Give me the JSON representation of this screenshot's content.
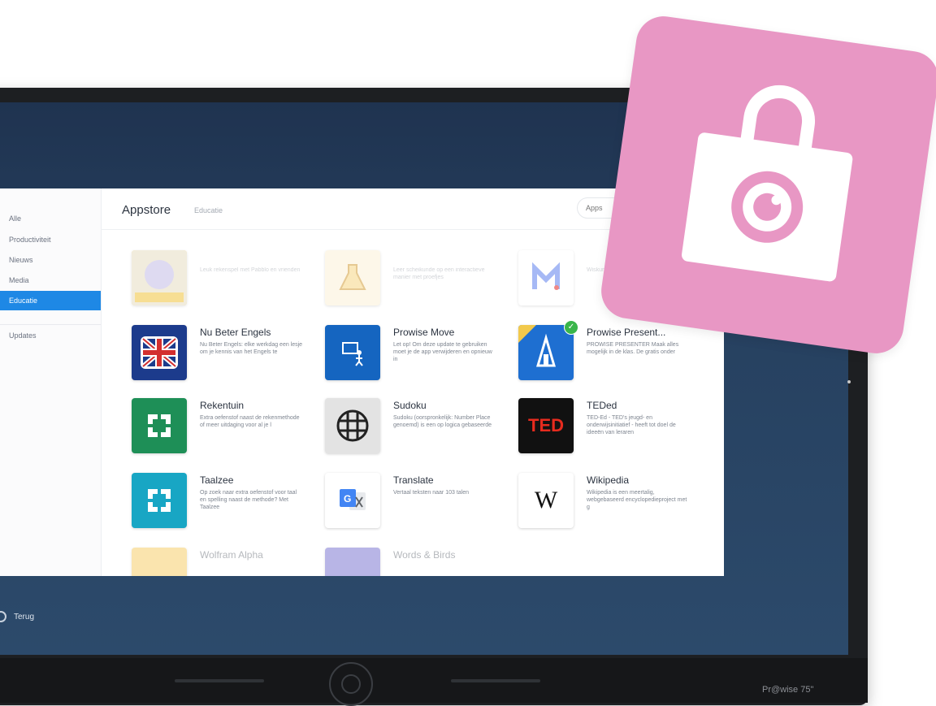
{
  "sidebar": {
    "items": [
      {
        "label": "Alle",
        "active": false
      },
      {
        "label": "Productiviteit",
        "active": false
      },
      {
        "label": "Nieuws",
        "active": false
      },
      {
        "label": "Media",
        "active": false
      },
      {
        "label": "Educatie",
        "active": true
      },
      {
        "label": "Updates",
        "active": false
      }
    ]
  },
  "header": {
    "title": "Appstore",
    "breadcrumb": "Educatie",
    "search_placeholder": "Apps"
  },
  "apps": [
    {
      "name": "",
      "description": "Leuk rekenspel met Pabblo en vrienden",
      "icon": "pabblo-icon",
      "color": "#f2c94c",
      "faded": true
    },
    {
      "name": "",
      "description": "Leer scheikunde op een interactieve manier met proefjes",
      "icon": "flask-icon",
      "color": "#fdf3dc",
      "faded": true
    },
    {
      "name": "",
      "description": "Wiskunde oefenen op een leuke manier",
      "icon": "m-letter-icon",
      "color": "#ffffff",
      "faded": true
    },
    {
      "name": "Nu Beter Engels",
      "description": "Nu Beter Engels: elke werkdag een lesje om je kennis van het Engels te",
      "icon": "uk-flag-icon",
      "color": "#1c3b8c",
      "faded": false
    },
    {
      "name": "Prowise Move",
      "description": "Let op! Om deze update te gebruiken moet je de app verwijderen en opnieuw in",
      "icon": "move-icon",
      "color": "#1565c0",
      "faded": false
    },
    {
      "name": "Prowise Present...",
      "description": "PROWISE PRESENTER Maak alles mogelijk in de klas. De gratis onder",
      "icon": "present-icon",
      "color": "#1e6fd1",
      "faded": false,
      "installed": true
    },
    {
      "name": "Rekentuin",
      "description": "Extra oefenstof naast de rekenmethode of meer uitdaging voor al je l",
      "icon": "rekentuin-icon",
      "color": "#1e8f57",
      "faded": false
    },
    {
      "name": "Sudoku",
      "description": "Sudoku (oorspronkelijk: Number Place genoemd) is een op logica gebaseerde",
      "icon": "sudoku-icon",
      "color": "#e3e3e3",
      "faded": false
    },
    {
      "name": "TEDed",
      "description": "TED-Ed - TED's jeugd- en onderwijsinitiatief - heeft tot doel de ideeën van leraren",
      "icon": "ted-icon",
      "color": "#111111",
      "faded": false,
      "icon_text": "TED"
    },
    {
      "name": "Taalzee",
      "description": "Op zoek naar extra oefenstof voor taal en spelling naast de methode? Met Taalzee",
      "icon": "taalzee-icon",
      "color": "#18a6c4",
      "faded": false
    },
    {
      "name": "Translate",
      "description": "Vertaal teksten naar 103 talen",
      "icon": "translate-icon",
      "color": "#ffffff",
      "faded": false
    },
    {
      "name": "Wikipedia",
      "description": "Wikipedia is een meertalig, webgebaseerd encyclopedieproject met g",
      "icon": "wikipedia-icon",
      "color": "#ffffff",
      "faded": false,
      "icon_text": "W"
    },
    {
      "name": "Wolfram Alpha",
      "description": "",
      "icon": "wolfram-icon",
      "color": "#f7d37a",
      "faded": true
    },
    {
      "name": "Words & Birds",
      "description": "",
      "icon": "words-birds-icon",
      "color": "#8a84d6",
      "faded": true
    }
  ],
  "footer": {
    "back_label": "Terug",
    "brand_label": "Pr@wise 75\""
  },
  "colors": {
    "accent": "#1e88e5",
    "badge": "#e897c4",
    "screen_bg": "#26405f"
  }
}
